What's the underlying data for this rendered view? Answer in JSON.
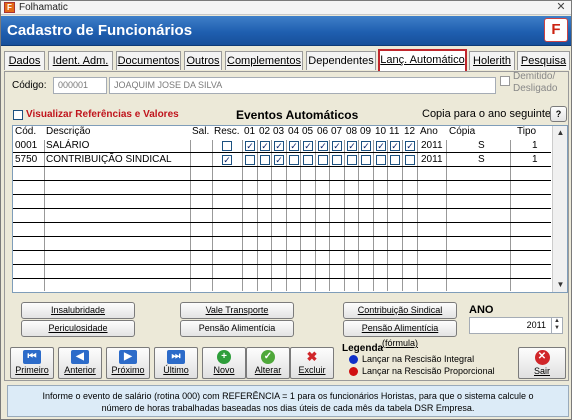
{
  "titlebar": {
    "app_title": "Folhamatic",
    "icon_letter": "F",
    "close_glyph": "✕"
  },
  "header": {
    "title": "Cadastro de Funcionários",
    "logo_letter": "F"
  },
  "tabs": [
    {
      "label": "Dados"
    },
    {
      "label": "Ident. Adm."
    },
    {
      "label": "Documentos"
    },
    {
      "label": "Outros"
    },
    {
      "label": "Complementos"
    },
    {
      "label": "Dependentes"
    },
    {
      "label": "Lanç. Automático"
    },
    {
      "label": "Holerith"
    },
    {
      "label": "Pesquisa"
    }
  ],
  "form": {
    "codigo_label": "Código:",
    "codigo_value": "000001",
    "nome_value": "JOAQUIM JOSE DA SILVA",
    "demitido_label_1": "Demitido/",
    "demitido_label_2": "Desligado"
  },
  "eventos": {
    "visualizar_label": "Visualizar Referências e Valores",
    "section_title": "Eventos Automáticos",
    "copia_label": "Copia para o ano seguinte",
    "help_glyph": "?",
    "columns": {
      "cod": "Cód.",
      "descricao": "Descrição",
      "sal": "Sal.",
      "resc": "Resc.",
      "months": [
        "01",
        "02",
        "03",
        "04",
        "05",
        "06",
        "07",
        "08",
        "09",
        "10",
        "11",
        "12"
      ],
      "ano": "Ano",
      "copia": "Cópia",
      "tipo": "Tipo"
    },
    "rows": [
      {
        "cod": "0001",
        "descricao": "SALÁRIO",
        "resc": false,
        "months": [
          true,
          true,
          true,
          true,
          true,
          true,
          true,
          true,
          true,
          true,
          true,
          true
        ],
        "ano": "2011",
        "copia": "S",
        "tipo": "1"
      },
      {
        "cod": "5750",
        "descricao": "CONTRIBUIÇÃO SINDICAL",
        "resc": true,
        "months": [
          false,
          false,
          true,
          false,
          false,
          false,
          false,
          false,
          false,
          false,
          false,
          false
        ],
        "ano": "2011",
        "copia": "S",
        "tipo": "1"
      }
    ],
    "check_glyph": "✓",
    "scroll_up": "▲",
    "scroll_down": "▼"
  },
  "actions": {
    "insalubridade": "Insalubridade",
    "periculosidade": "Periculosidade",
    "vale_transporte": "Vale Transporte",
    "pensao_alimenticia": "Pensão Alimentícia",
    "contribuicao_sindical": "Contribuição Sindical",
    "pensao_formula": "Pensão Alimentícia (fórmula)"
  },
  "ano": {
    "label": "ANO",
    "value": "2011"
  },
  "nav": {
    "primeiro": "Primeiro",
    "anterior": "Anterior",
    "proximo": "Próximo",
    "ultimo": "Último",
    "novo": "Novo",
    "alterar": "Alterar",
    "excluir": "Excluir",
    "sair": "Sair"
  },
  "legenda": {
    "title": "Legenda",
    "integral": "Lançar na Rescisão Integral",
    "proporcional": "Lançar na Rescisão Proporcional",
    "integral_color": "#1030c8",
    "proporcional_color": "#d01010"
  },
  "footer": {
    "line1": "Informe o evento de salário (rotina 000) com REFERÊNCIA = 1 para os funcionários Horistas, para que o sistema calcule o",
    "line2": "número de horas trabalhadas baseadas nos dias úteis de cada mês da tabela DSR Empresa."
  },
  "colors": {
    "header_blue": "#1f5fb0",
    "active_tab_border": "#c0262c",
    "red_label": "#c0141c"
  }
}
